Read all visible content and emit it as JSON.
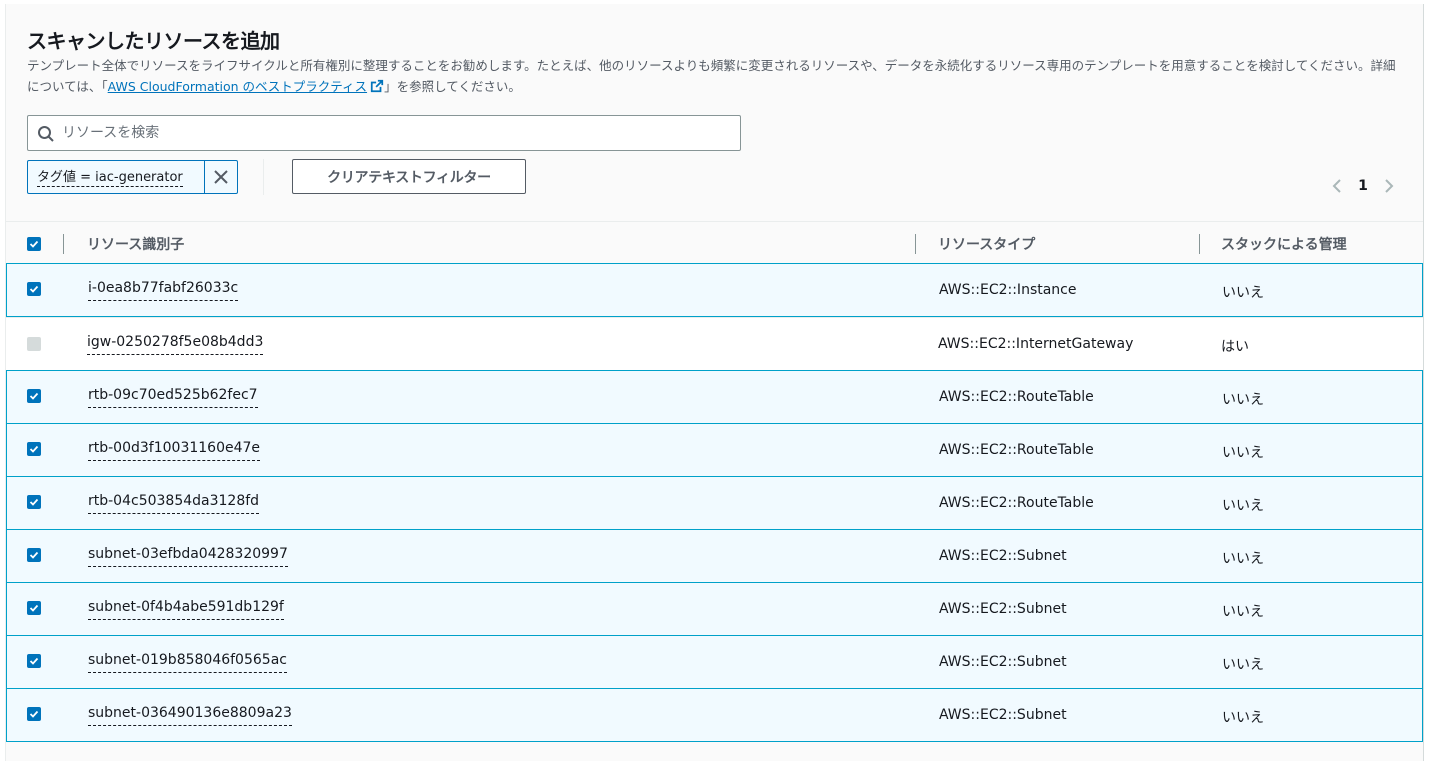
{
  "header": {
    "title": "スキャンしたリソースを追加",
    "description_before": "テンプレート全体でリソースをライフサイクルと所有権別に整理することをお勧めします。たとえば、他のリソースよりも頻繁に変更されるリソースや、データを永続化するリソース専用のテンプレートを用意することを検討してください。詳細については、「",
    "description_link": "AWS CloudFormation のベストプラクティス",
    "description_after": "」を参照してください。"
  },
  "search": {
    "placeholder": "リソースを検索",
    "value": ""
  },
  "filter_token": {
    "label": "タグ値 = iac-generator"
  },
  "clear_button": {
    "label": "クリアテキストフィルター"
  },
  "pagination": {
    "current_page": "1"
  },
  "table": {
    "columns": [
      "リソース識別子",
      "リソースタイプ",
      "スタックによる管理"
    ],
    "rows": [
      {
        "id": "i-0ea8b77fabf26033c",
        "type": "AWS::EC2::Instance",
        "managed": "いいえ",
        "selected": true
      },
      {
        "id": "igw-0250278f5e08b4dd3",
        "type": "AWS::EC2::InternetGateway",
        "managed": "はい",
        "selected": false
      },
      {
        "id": "rtb-09c70ed525b62fec7",
        "type": "AWS::EC2::RouteTable",
        "managed": "いいえ",
        "selected": true
      },
      {
        "id": "rtb-00d3f10031160e47e",
        "type": "AWS::EC2::RouteTable",
        "managed": "いいえ",
        "selected": true
      },
      {
        "id": "rtb-04c503854da3128fd",
        "type": "AWS::EC2::RouteTable",
        "managed": "いいえ",
        "selected": true
      },
      {
        "id": "subnet-03efbda0428320997",
        "type": "AWS::EC2::Subnet",
        "managed": "いいえ",
        "selected": true
      },
      {
        "id": "subnet-0f4b4abe591db129f",
        "type": "AWS::EC2::Subnet",
        "managed": "いいえ",
        "selected": true
      },
      {
        "id": "subnet-019b858046f0565ac",
        "type": "AWS::EC2::Subnet",
        "managed": "いいえ",
        "selected": true
      },
      {
        "id": "subnet-036490136e8809a23",
        "type": "AWS::EC2::Subnet",
        "managed": "いいえ",
        "selected": true
      }
    ]
  },
  "colors": {
    "accent": "#0073bb",
    "selected_row_bg": "#f1faff",
    "selected_row_border": "#00a1c9"
  }
}
